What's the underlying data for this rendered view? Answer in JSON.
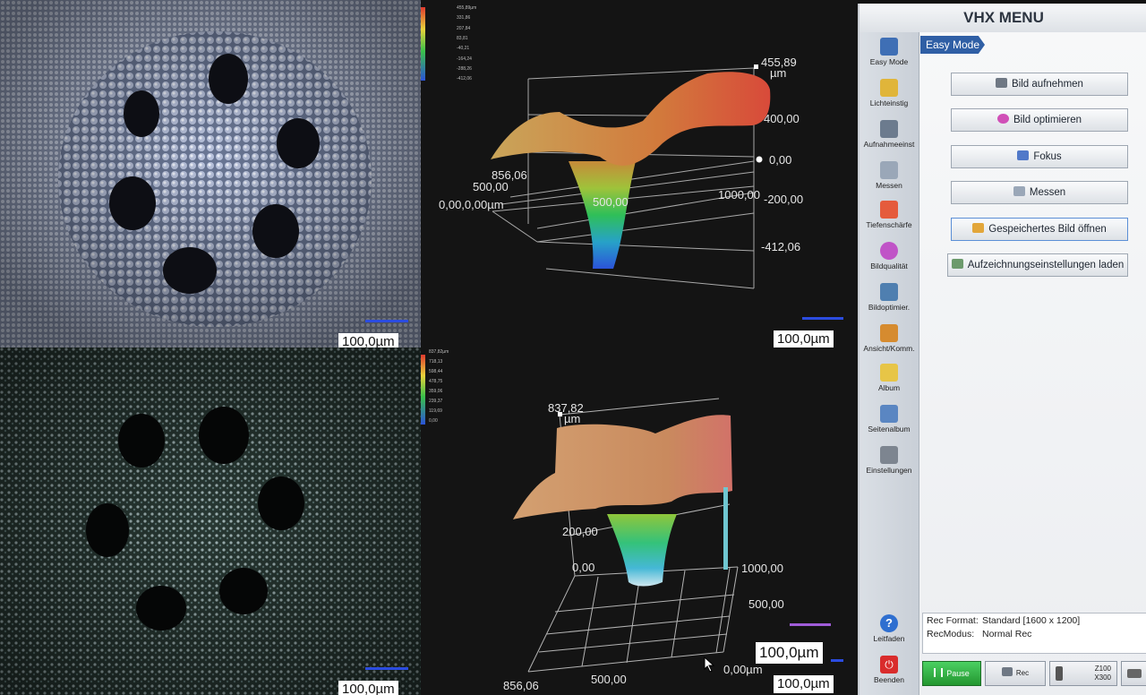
{
  "menu": {
    "title": "VHX MENU",
    "sidebar": [
      {
        "label": "Easy Mode",
        "icon": "person-icon",
        "color": "#3f6fb5"
      },
      {
        "label": "Lichteinstig",
        "icon": "bulb-icon",
        "color": "#e0b53a"
      },
      {
        "label": "Aufnahmeeinst",
        "icon": "camera-settings-icon",
        "color": "#6c7b8e"
      },
      {
        "label": "Messen",
        "icon": "ruler-icon",
        "color": "#9aa7b8"
      },
      {
        "label": "Tiefenschärfe",
        "icon": "depth-icon",
        "color": "#e55b3c"
      },
      {
        "label": "Bildqualität",
        "icon": "color-wheel-icon",
        "color": "#c054c7"
      },
      {
        "label": "Bildoptimier.",
        "icon": "image-optimize-icon",
        "color": "#4f7fb0"
      },
      {
        "label": "Ansicht/Komm.",
        "icon": "view-comment-icon",
        "color": "#d68b2f"
      },
      {
        "label": "Album",
        "icon": "folder-icon",
        "color": "#e7c547"
      },
      {
        "label": "Seitenalbum",
        "icon": "page-album-icon",
        "color": "#5a86c2"
      },
      {
        "label": "Einstellungen",
        "icon": "tools-icon",
        "color": "#7d8590"
      }
    ],
    "help_label": "Leitfaden",
    "exit_label": "Beenden",
    "mode_tab": "Easy Mode",
    "buttons": [
      {
        "label": "Bild aufnehmen",
        "icon": "camera-icon",
        "color": "#6f7884"
      },
      {
        "label": "Bild optimieren",
        "icon": "color-wheel-icon",
        "color": "#d04fb7"
      },
      {
        "label": "Fokus",
        "icon": "focus-icon",
        "color": "#5179c9"
      },
      {
        "label": "Messen",
        "icon": "ruler-icon",
        "color": "#9aa7b8"
      },
      {
        "label": "Gespeichertes Bild öffnen",
        "icon": "open-image-icon",
        "color": "#e2a63a"
      },
      {
        "label": "Aufzeichnungseinstellungen laden",
        "icon": "load-settings-icon",
        "color": "#6c9a6c"
      }
    ],
    "rec_format_label": "Rec Format:",
    "rec_format_value": "Standard [1600 x 1200]",
    "rec_mode_label": "RecModus:",
    "rec_mode_value": "Normal Rec",
    "bottom": {
      "pause": "Pause",
      "rec": "Rec",
      "zoom_z": "Z100",
      "zoom_x": "X300"
    }
  },
  "viewer": {
    "scale_tl": "100,0µm",
    "scale_tr": "100,0µm",
    "scale_bl": "100,0µm",
    "scale_br": "100,0µm",
    "scale_br_mid": "100,0µm",
    "top3d": {
      "zmax": "455,89",
      "unit": "µm",
      "z_400": "400,00",
      "z_0": "0,00",
      "z_neg200": "-200,00",
      "z_min": "-412,06",
      "x_856": "856,06",
      "y_500": "500,00",
      "origin": "0,00,0,00µm",
      "x_mid": "500,00",
      "x_1000": "1000,00",
      "colorbar": [
        "455,89µm",
        "331,86",
        "207,84",
        "83,81",
        "-40,21",
        "-164,24",
        "-288,26",
        "-412,06"
      ]
    },
    "bottom3d": {
      "zmax": "837,82",
      "unit": "µm",
      "z_200": "200,00",
      "z_0": "0,00",
      "x_1000": "1000,00",
      "x_500": "500,00",
      "y_500": "500,00",
      "y_origin": "0,00µm",
      "y_856": "856,06",
      "colorbar": [
        "837,82µm",
        "718,13",
        "598,44",
        "478,75",
        "359,06",
        "239,37",
        "119,69",
        "0,00"
      ]
    }
  },
  "colors": {
    "menu_accent": "#2f5fa5",
    "pause_green": "#2eb34a",
    "scale_blue": "#2b4ce0",
    "scale_purple": "#a05cd8"
  }
}
